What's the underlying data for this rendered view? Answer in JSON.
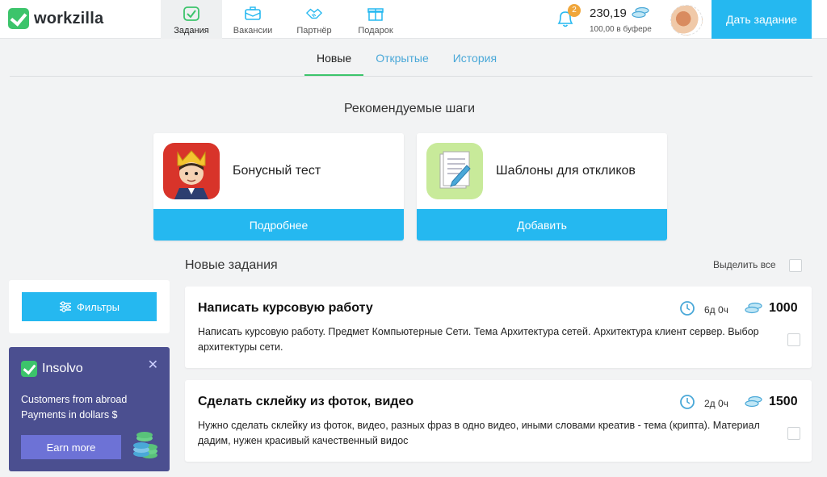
{
  "header": {
    "logo_text": "workzilla",
    "nav": [
      {
        "label": "Задания",
        "icon": "task-check-icon",
        "active": true
      },
      {
        "label": "Вакансии",
        "icon": "briefcase-icon",
        "active": false
      },
      {
        "label": "Партнёр",
        "icon": "handshake-icon",
        "active": false
      },
      {
        "label": "Подарок",
        "icon": "gift-icon",
        "active": false
      }
    ],
    "notifications_count": "2",
    "balance": "230,19",
    "buffer_text": "100,00 в буфере",
    "cta_label": "Дать задание"
  },
  "tabs": [
    {
      "label": "Новые",
      "active": true
    },
    {
      "label": "Открытые",
      "active": false
    },
    {
      "label": "История",
      "active": false
    }
  ],
  "recommended": {
    "title": "Рекомендуемые шаги",
    "cards": [
      {
        "text": "Бонусный тест",
        "button": "Подробнее",
        "icon": "king-avatar-icon"
      },
      {
        "text": "Шаблоны для откликов",
        "button": "Добавить",
        "icon": "document-pen-icon"
      }
    ]
  },
  "tasks_section": {
    "title": "Новые задания",
    "select_all": "Выделить все"
  },
  "tasks": [
    {
      "title": "Написать курсовую работу",
      "description": "Написать курсовую работу. Предмет Компьютерные Сети. Тема Архитектура сетей. Архитектура клиент сервер. Выбор архитектуры сети.",
      "duration": "6д 0ч",
      "price": "1000"
    },
    {
      "title": "Сделать склейку из фоток, видео",
      "description": "Нужно сделать склейку из фоток, видео, разных фраз в одно видео, иными словами креатив - тема (крипта). Материал дадим, нужен красивый качественный видос",
      "duration": "2д 0ч",
      "price": "1500"
    }
  ],
  "sidebar": {
    "filter_label": "Фильтры",
    "ad": {
      "brand": "Insolvo",
      "text": "Customers from abroad Payments in dollars $",
      "button": "Earn more"
    }
  },
  "colors": {
    "accent": "#25b8f0",
    "brand_green": "#3cc46b",
    "ad_bg": "#4b4f90"
  }
}
